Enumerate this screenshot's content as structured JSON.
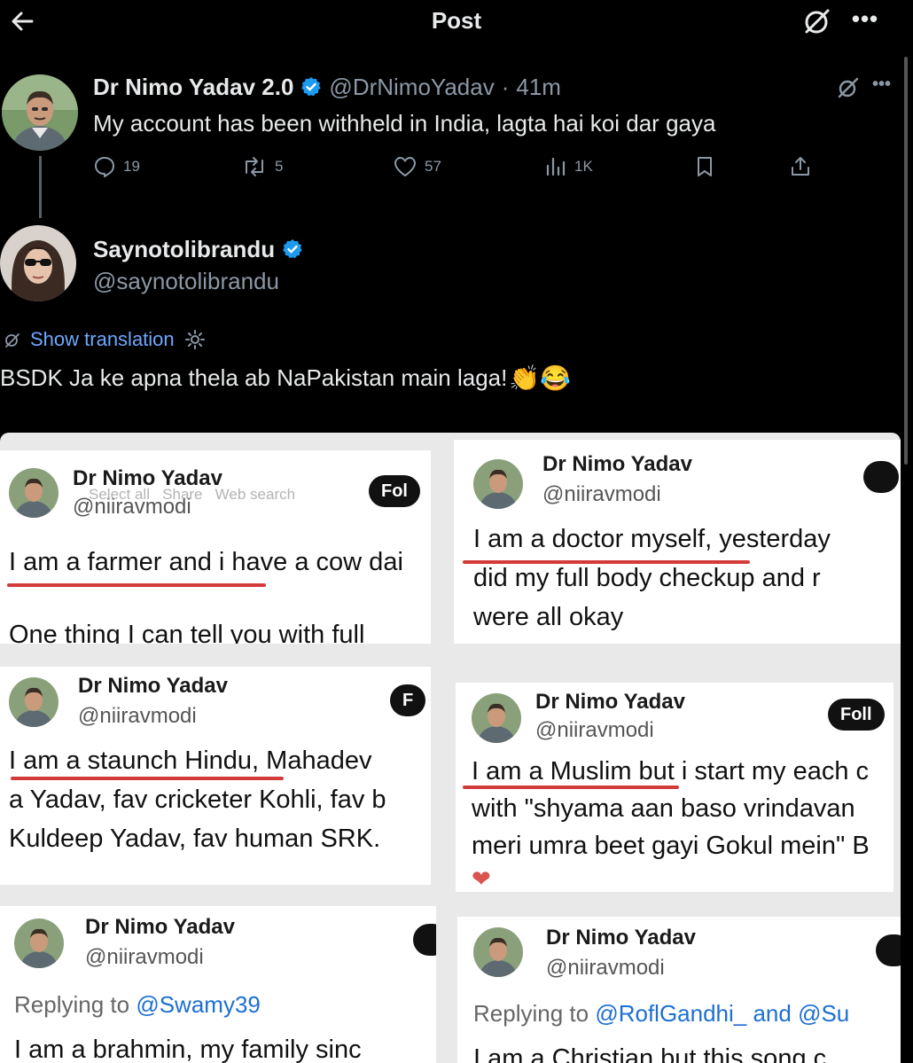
{
  "header": {
    "title": "Post",
    "more": "•••"
  },
  "tweet": {
    "author_name": "Dr Nimo Yadav 2.0",
    "author_handle": "@DrNimoYadav",
    "separator": "·",
    "time": "41m",
    "text": "My account has been withheld in India, lagta hai koi dar gaya",
    "stats": {
      "replies": "19",
      "retweets": "5",
      "likes": "57",
      "views": "1K"
    },
    "more": "•••"
  },
  "reply": {
    "author_name": "Saynotolibrandu",
    "author_handle": "@saynotolibrandu",
    "show_translation": "Show translation",
    "text": "BSDK Ja ke apna thela ab NaPakistan main laga!",
    "emoji": "👏😂"
  },
  "collage": {
    "cards": [
      {
        "name": "Dr Nimo Yadav",
        "handle": "@niiravmodi",
        "follow": "Fol",
        "overlay": "Select all   Share   Web search",
        "lines": [
          "I am a farmer and i have a cow dai",
          "",
          "One thing I can tell you with full"
        ]
      },
      {
        "name": "Dr Nimo Yadav",
        "handle": "@niiravmodi",
        "lines": [
          "I am a doctor myself, yesterday",
          "did my full body checkup and r",
          "were all okay"
        ]
      },
      {
        "name": "Dr Nimo Yadav",
        "handle": "@niiravmodi",
        "follow": "F",
        "lines": [
          "I am a staunch Hindu, Mahadev",
          "a Yadav, fav cricketer Kohli, fav b",
          "Kuldeep Yadav, fav human SRK."
        ]
      },
      {
        "name": "Dr Nimo Yadav",
        "handle": "@niiravmodi",
        "follow": "Foll",
        "lines": [
          "I am a Muslim but i start my each c",
          "with \"shyama aan baso vrindavan",
          "meri umra beet gayi Gokul mein\" B"
        ],
        "reaction": "❤"
      },
      {
        "name": "Dr Nimo Yadav",
        "handle": "@niiravmodi",
        "replying_prefix": "Replying to ",
        "replying_to": "@Swamy39",
        "lines": [
          "I am a brahmin, my family sinc"
        ]
      },
      {
        "name": "Dr Nimo Yadav",
        "handle": "@niiravmodi",
        "replying_prefix": "Replying to ",
        "replying_to": "@RoflGandhi_ and @Su",
        "lines": [
          "I am a Christian but this song c"
        ]
      }
    ]
  },
  "colors": {
    "background": "#000000",
    "text": "#e7e9ea",
    "muted": "#8b98a5",
    "link": "#6ea8ff",
    "verified": "#1d9bf0",
    "highlight_underline": "#d33b3b"
  },
  "icons": [
    "back-arrow-icon",
    "grok-icon",
    "more-icon",
    "verified-icon",
    "reply-icon",
    "retweet-icon",
    "like-icon",
    "views-icon",
    "bookmark-icon",
    "share-icon",
    "translate-icon",
    "settings-icon"
  ]
}
